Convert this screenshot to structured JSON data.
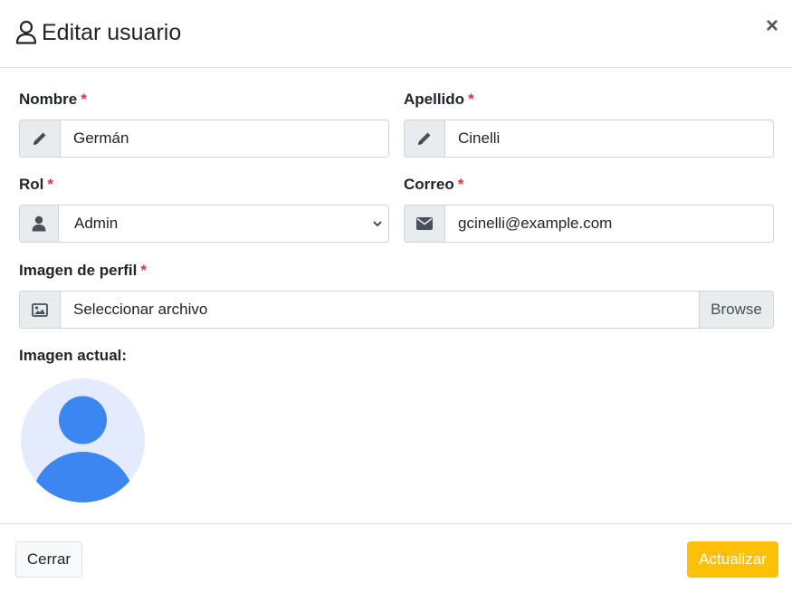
{
  "modal": {
    "title": "Editar usuario",
    "title_icon": "user-outline-icon",
    "close_glyph": "×"
  },
  "form": {
    "required_mark": "*",
    "nombre": {
      "label": "Nombre",
      "value": "Germán",
      "icon": "pencil-icon"
    },
    "apellido": {
      "label": "Apellido",
      "value": "Cinelli",
      "icon": "pencil-icon"
    },
    "rol": {
      "label": "Rol",
      "selected": "Admin",
      "icon": "user-icon"
    },
    "correo": {
      "label": "Correo",
      "value": "gcinelli@example.com",
      "icon": "envelope-icon"
    },
    "imagen_perfil": {
      "label": "Imagen de perfil",
      "placeholder": "Seleccionar archivo",
      "browse_label": "Browse",
      "icon": "image-icon"
    },
    "imagen_actual": {
      "label": "Imagen actual:"
    }
  },
  "footer": {
    "close_label": "Cerrar",
    "update_label": "Actualizar"
  },
  "colors": {
    "required": "#dc3545",
    "update_button": "#ffc107",
    "avatar_bg": "#e3ebfc",
    "avatar_fg": "#3b86f0"
  }
}
